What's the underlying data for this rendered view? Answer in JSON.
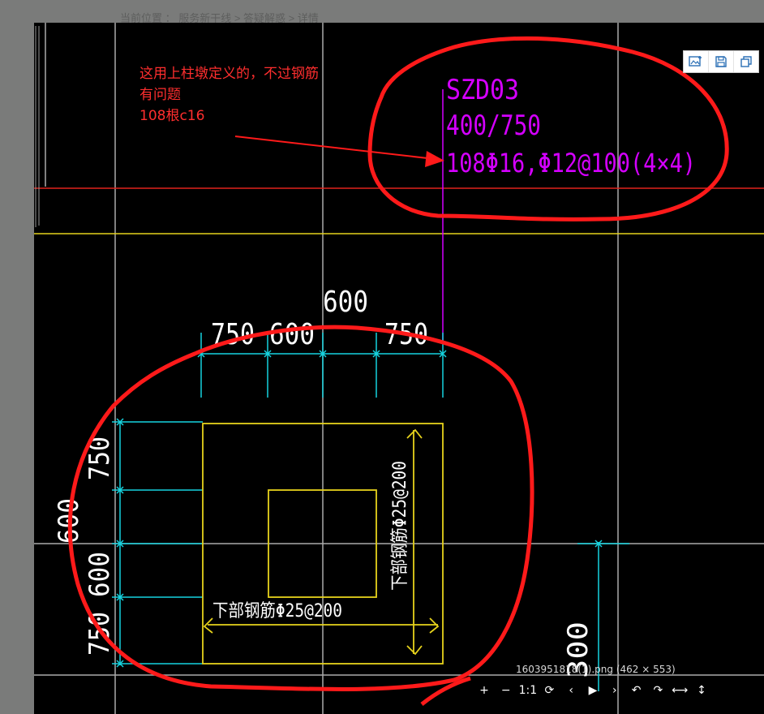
{
  "breadcrumb": "当前位置 ： 服务新干线 > 答疑解惑 > 详情",
  "annotation": {
    "lines": [
      "这用上柱墩定义的，不过钢筋",
      "有问题",
      "108根c16"
    ],
    "color": "#ff2e2e"
  },
  "cad": {
    "column_label": {
      "name": "SZD03",
      "size": "400/750",
      "rebar": "108Φ16,Φ12@100(4×4)",
      "color": "#d400ff"
    },
    "dims_top": {
      "total": "600",
      "left": "750",
      "middle": "600",
      "right": "750"
    },
    "dims_left": {
      "total": "600",
      "top": "750",
      "middle": "600",
      "bottom": "750"
    },
    "dim_right_partial": "300",
    "rebar_notes": {
      "vertical": "下部钢筋Φ25@200",
      "horizontal": "下部钢筋Φ25@200"
    },
    "colors": {
      "dimension": "#16d3df",
      "outline": "#e6d21c",
      "grid": "#c9c9c9",
      "axis_red": "#e0231c",
      "markup": "#ff1a1a"
    }
  },
  "viewer": {
    "filename_info": "1603951818(1).png (462 × 553)",
    "toolbar": [
      "edit-image-icon",
      "save-icon",
      "copy-icon"
    ],
    "controls": [
      "+",
      "−",
      "1:1",
      "⟳",
      "‹",
      "▶",
      "›",
      "↶",
      "↷",
      "⟷",
      "↕"
    ]
  }
}
